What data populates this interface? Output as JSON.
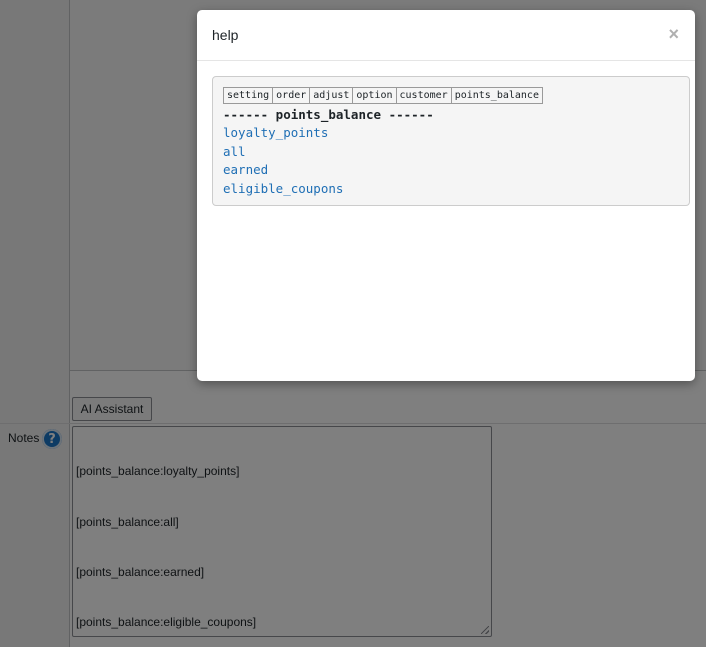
{
  "page": {
    "ai_button_label": "AI Assistant",
    "notes_label": "Notes",
    "help_icon_glyph": "?",
    "notes_lines": [
      "[points_balance:loyalty_points]",
      "[points_balance:all]",
      "[points_balance:earned]",
      "[points_balance:eligible_coupons]"
    ]
  },
  "modal": {
    "title": "help",
    "close_glyph": "×",
    "tabs": [
      "setting",
      "order",
      "adjust",
      "option",
      "customer",
      "points_balance"
    ],
    "section_heading": "------ points_balance ------",
    "options": [
      "loyalty_points",
      "all",
      "earned",
      "eligible_coupons"
    ]
  },
  "colors": {
    "link": "#1f6fb5",
    "help_icon": "#1a76c9",
    "overlay": "rgba(0,0,0,0.5)"
  }
}
